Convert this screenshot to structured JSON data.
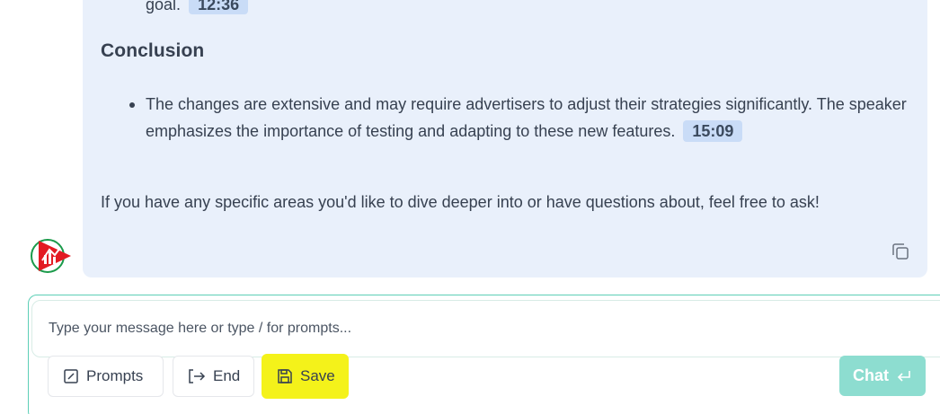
{
  "message": {
    "prev_fragment": "goal.",
    "prev_timestamp": "12:36",
    "heading": "Conclusion",
    "bullets": [
      {
        "text": "The changes are extensive and may require advertisers to adjust their strategies significantly. The speaker emphasizes the importance of testing and adapting to these new features.",
        "timestamp": "15:09"
      }
    ],
    "closing": "If you have any specific areas you'd like to dive deeper into or have questions about, feel free to ask!",
    "copy_icon": "copy-icon"
  },
  "avatar": {
    "icon": "brand-logo",
    "colors": {
      "primary": "#e31b23",
      "secondary": "#1a9a4a"
    }
  },
  "composer": {
    "placeholder": "Type your message here or type / for prompts...",
    "value": "",
    "buttons": {
      "prompts": "Prompts",
      "end": "End",
      "save": "Save",
      "chat": "Chat"
    },
    "icons": {
      "prompts": "edit-square-icon",
      "end": "exit-arrow-icon",
      "save": "save-disk-icon",
      "chat": "enter-return-icon"
    }
  },
  "colors": {
    "bubble_bg": "#e9f0fb",
    "timestamp_bg": "#c9dcf7",
    "accent_teal": "#5ccfb6",
    "chat_button": "#8dddd0",
    "highlight_yellow": "#f4f21a"
  }
}
